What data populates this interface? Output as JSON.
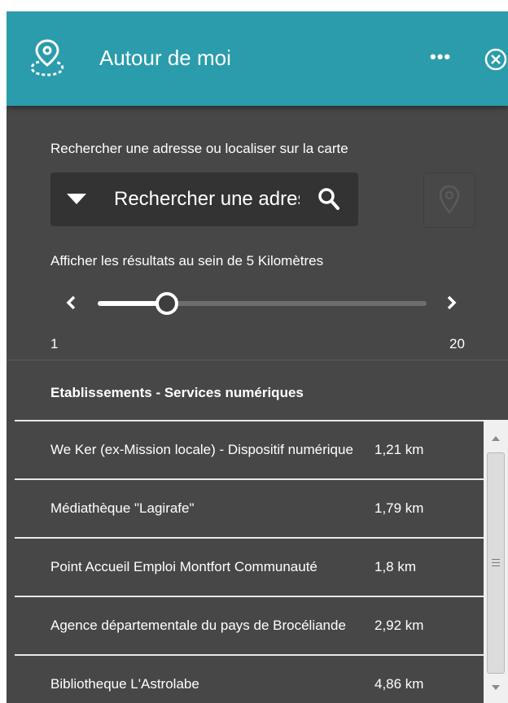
{
  "header": {
    "title": "Autour de moi",
    "icon": "location-pin-icon",
    "more_icon": "more-options-icon",
    "more_glyph": "•••",
    "close_icon": "close-icon"
  },
  "search": {
    "label": "Rechercher une adresse ou localiser sur la carte",
    "placeholder": "Rechercher une adresse",
    "dropdown_icon": "dropdown-arrow-icon",
    "search_icon": "search-icon",
    "locate_icon": "locate-me-icon"
  },
  "radius": {
    "label": "Afficher les résultats au sein de 5 Kilomètres",
    "min_label": "1",
    "max_label": "20",
    "min": 1,
    "max": 20,
    "value": 5
  },
  "results": {
    "section_title": "Etablissements - Services numériques",
    "items": [
      {
        "name": "We Ker (ex-Mission locale) - Dispositif numérique",
        "distance": "1,21 km"
      },
      {
        "name": "Médiathèque \"Lagirafe\"",
        "distance": "1,79 km"
      },
      {
        "name": "Point Accueil Emploi Montfort Communauté",
        "distance": "1,8 km"
      },
      {
        "name": "Agence départementale du pays de Brocéliande",
        "distance": "2,92 km"
      },
      {
        "name": "Bibliotheque L'Astrolabe",
        "distance": "4,86 km"
      }
    ]
  },
  "colors": {
    "header": "#2a9cac",
    "panel": "#474747",
    "search_box": "#333333",
    "text": "#ffffff"
  }
}
